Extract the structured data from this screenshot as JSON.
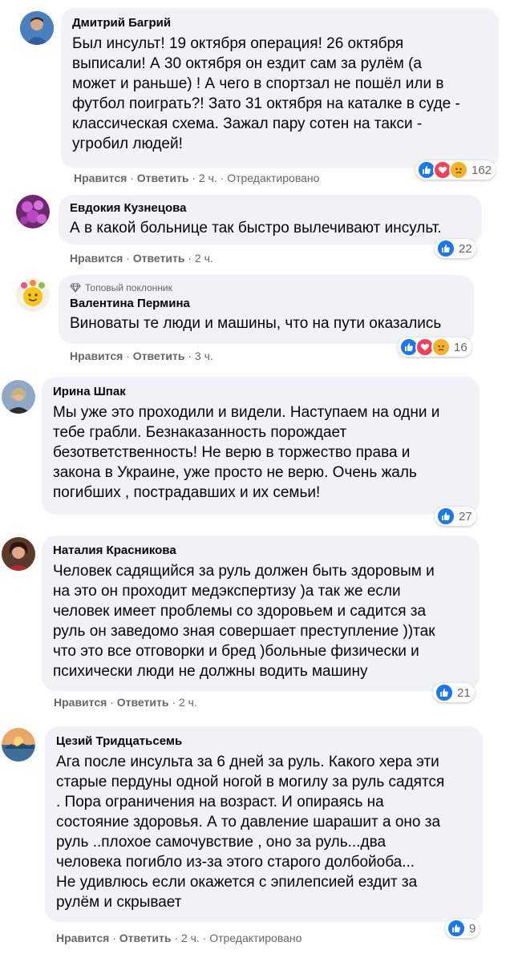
{
  "actions": {
    "like": "Нравится",
    "reply": "Ответить",
    "sep": "·",
    "edited": "Отредактировано"
  },
  "colors": {
    "bubble": "#f0f2f5",
    "like_blue": "#1877f2",
    "love_red": "#f33e58",
    "sad_yellow": "#f7b125",
    "meta_gray": "#65676b"
  },
  "comments": [
    {
      "author": "Дмитрий Багрий",
      "lines": [
        "Был инсульт! 19 октября операция! 26 октября",
        "выписали! А 30 октября он ездит сам за рулём (а",
        "может и раньше) ! А чего в спортзал не пошёл или в",
        "футбол поиграть?! Зато 31 октября на каталке в суде -",
        "классическая схема. Зажал пару сотен на такси -",
        "угробил людей!"
      ],
      "time": "2 ч.",
      "edited": true,
      "reaction_icons": [
        "like-icon",
        "love-icon",
        "sad-icon"
      ],
      "reaction_count": "162"
    },
    {
      "author": "Евдокия Кузнецова",
      "lines": [
        "А в какой больнице так быстро вылечивают инсульт."
      ],
      "time": "2 ч.",
      "reaction_icons": [
        "like-icon"
      ],
      "reaction_count": "22"
    },
    {
      "badge": "Топовый поклонник",
      "author": "Валентина Пермина",
      "lines": [
        "Виноваты те люди и машины, что на пути оказались"
      ],
      "time": "3 ч.",
      "reaction_icons": [
        "like-icon",
        "love-icon",
        "sad-icon"
      ],
      "reaction_count": "16"
    },
    {
      "author": "Ирина Шпак",
      "lines": [
        "Мы уже это проходили и видели. Наступаем на одни и",
        "тебе грабли. Безнаказанность порождает",
        "безответственность! Не верю в торжество права и",
        "закона в Украине, уже просто не верю. Очень жаль",
        "погибших , пострадавших и их семьи!"
      ],
      "reaction_icons": [
        "like-icon"
      ],
      "reaction_count": "27"
    },
    {
      "author": "Наталия Красникова",
      "lines": [
        "Человек садящийся за руль должен быть здоровым и",
        "на это он проходит медэкспертизу )а так же если",
        "человек имеет проблемы со здоровьем и садится за",
        "руль он заведомо зная совершает преступление ))так",
        "что это все отговорки и бред )больные физически и",
        "психически люди не должны водить машину"
      ],
      "time": "2 ч.",
      "reaction_icons": [
        "like-icon"
      ],
      "reaction_count": "21"
    },
    {
      "author": "Цезий Тридцатьсемь",
      "lines": [
        "Ага после инсульта за 6 дней за руль. Какого хера эти",
        "старые пердуны одной ногой в могилу за руль садятся",
        ". Пора ограничения на возраст. И опираясь на",
        "состояние здоровья. А то давление шарашит а оно за",
        "руль ..плохое самочувствие , оно за руль...два",
        "человека погибло из-за этого старого долбойоба...",
        "Не удивлюсь если окажется с эпилепсией ездит за",
        "рулём и скрывает"
      ],
      "time": "2 ч.",
      "edited": true,
      "reaction_icons": [
        "like-icon"
      ],
      "reaction_count": "9"
    }
  ]
}
